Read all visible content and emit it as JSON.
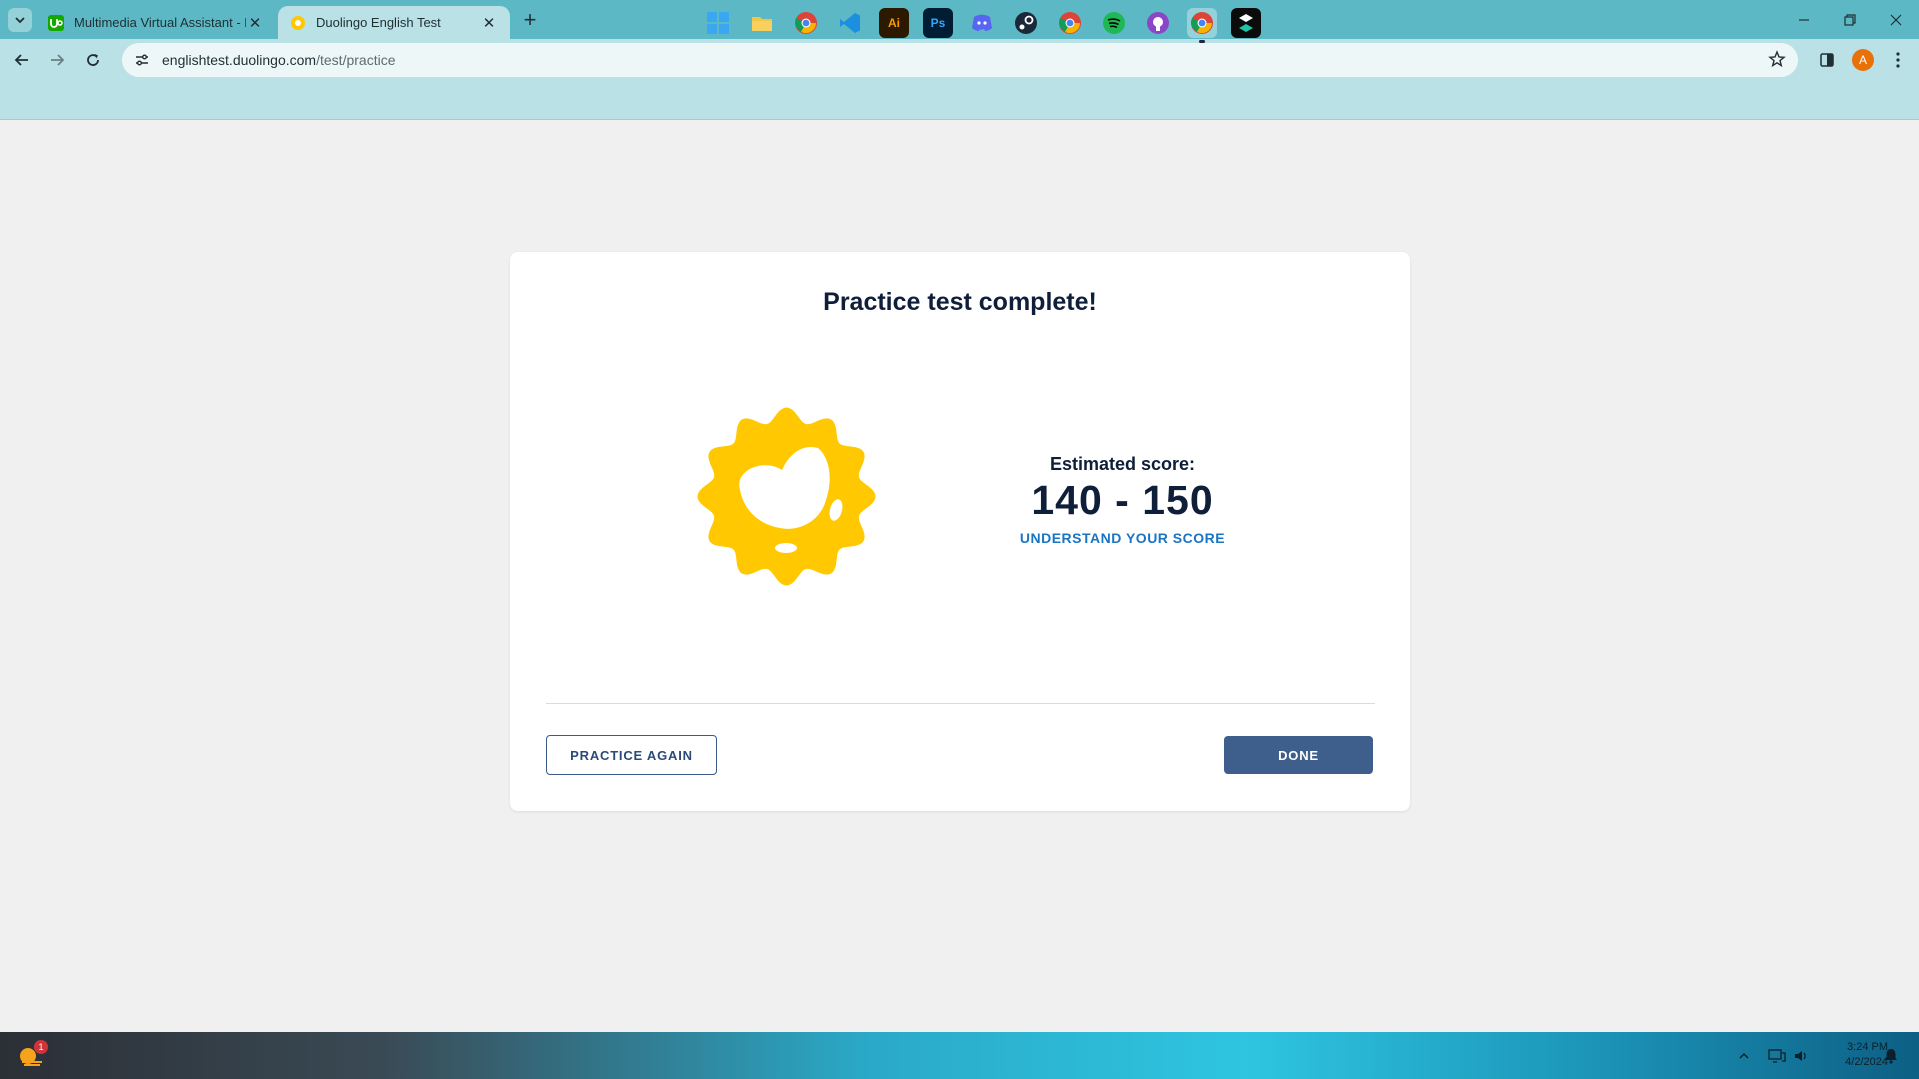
{
  "browser": {
    "tabs": [
      {
        "title": "Multimedia Virtual Assistant - P",
        "active": false,
        "favicon": "upwork-favicon"
      },
      {
        "title": "Duolingo English Test",
        "active": true,
        "favicon": "duolingo-favicon"
      }
    ],
    "url_domain": "englishtest.duolingo.com",
    "url_path": "/test/practice",
    "profile_initial": "A"
  },
  "card": {
    "title": "Practice test complete!",
    "score_label": "Estimated score:",
    "score_value": "140 - 150",
    "score_link": "UNDERSTAND YOUR SCORE",
    "practice_again_label": "PRACTICE AGAIN",
    "done_label": "DONE"
  },
  "taskbar": {
    "weather_badge": "1",
    "apps": [
      "windows-start-icon",
      "file-explorer-icon",
      "chrome-icon",
      "vscode-icon",
      "illustrator-icon",
      "photoshop-icon",
      "discord-icon",
      "steam-icon",
      "chrome-profile-icon",
      "spotify-icon",
      "github-icon",
      "chrome-active-icon",
      "capcut-icon"
    ],
    "illustrator_label": "Ai",
    "photoshop_label": "Ps",
    "time": "3:24 PM",
    "date": "4/2/2024"
  },
  "colors": {
    "tabstrip": "#5cb8c4",
    "toolbar": "#b9e1e6",
    "badge_yellow": "#ffc800",
    "done_button": "#3e5f8c",
    "link_blue": "#1a74c4"
  }
}
